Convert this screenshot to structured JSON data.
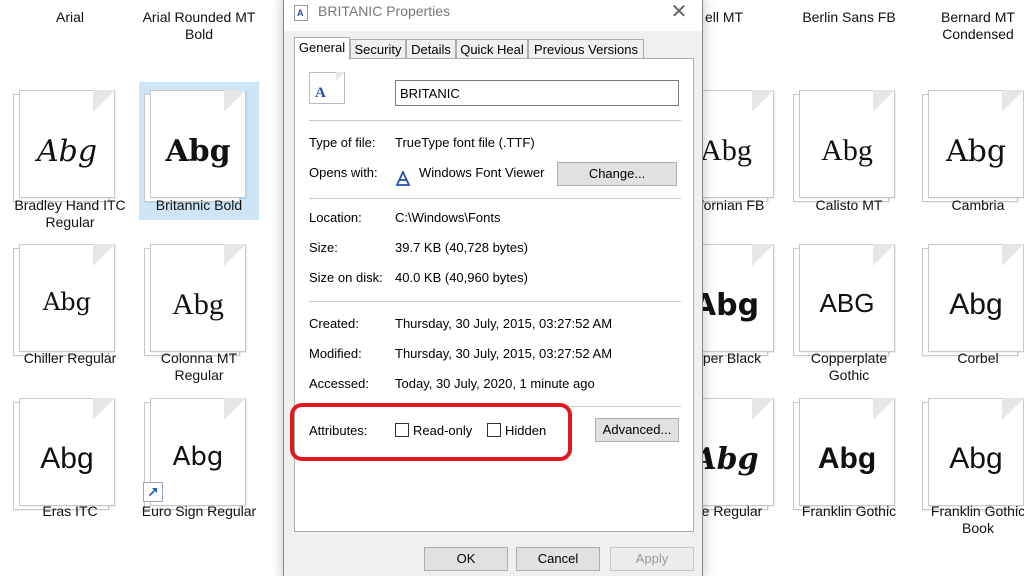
{
  "background_tiles": [
    {
      "label": "Arial"
    },
    {
      "label": "Arial Rounded MT Bold"
    },
    {
      "label": "ell MT"
    },
    {
      "label": "Berlin Sans FB"
    },
    {
      "label": "Bernard MT Condensed"
    },
    {
      "label": "Bradley Hand ITC Regular",
      "sample": "Abg"
    },
    {
      "label": "Britannic Bold",
      "sample": "Abg",
      "selected": true
    },
    {
      "label": "fornian FB",
      "sample": "Abg"
    },
    {
      "label": "Calisto MT",
      "sample": "Abg"
    },
    {
      "label": "Cambria",
      "sample": "Abg"
    },
    {
      "label": "Chiller Regular",
      "sample": "Abg"
    },
    {
      "label": "Colonna MT Regular",
      "sample": "Abg"
    },
    {
      "label": "per Black",
      "sample": "Abg"
    },
    {
      "label": "Copperplate Gothic",
      "sample": "ABG"
    },
    {
      "label": "Corbel",
      "sample": "Abg"
    },
    {
      "label": "Eras ITC",
      "sample": "Abg"
    },
    {
      "label": "Euro Sign Regular",
      "sample": "Abg"
    },
    {
      "label": "e Regular",
      "sample": "Abg"
    },
    {
      "label": "Franklin Gothic",
      "sample": "Abg"
    },
    {
      "label": "Franklin Gothic Book",
      "sample": "Abg"
    }
  ],
  "dialog": {
    "title": "BRITANIC Properties",
    "close_glyph": "✕",
    "tabs": [
      "General",
      "Security",
      "Details",
      "Quick Heal",
      "Previous Versions"
    ],
    "file_name": "BRITANIC",
    "type_of_file_label": "Type of file:",
    "type_of_file": "TrueType font file (.TTF)",
    "opens_with_label": "Opens with:",
    "opens_with": "Windows Font Viewer",
    "change_button": "Change...",
    "location_label": "Location:",
    "location": "C:\\Windows\\Fonts",
    "size_label": "Size:",
    "size": "39.7 KB (40,728 bytes)",
    "size_on_disk_label": "Size on disk:",
    "size_on_disk": "40.0 KB (40,960 bytes)",
    "created_label": "Created:",
    "created": "Thursday, 30 July, 2015, 03:27:52 AM",
    "modified_label": "Modified:",
    "modified": "Thursday, 30 July, 2015, 03:27:52 AM",
    "accessed_label": "Accessed:",
    "accessed": "Today, 30 July, 2020, 1 minute ago",
    "attributes_label": "Attributes:",
    "readonly_label": "Read-only",
    "hidden_label": "Hidden",
    "advanced_button": "Advanced...",
    "ok_button": "OK",
    "cancel_button": "Cancel",
    "apply_button": "Apply"
  },
  "colors": {
    "highlight": "#e0191c",
    "selection": "#cde5f7",
    "icon_blue": "#2a4bb0"
  }
}
